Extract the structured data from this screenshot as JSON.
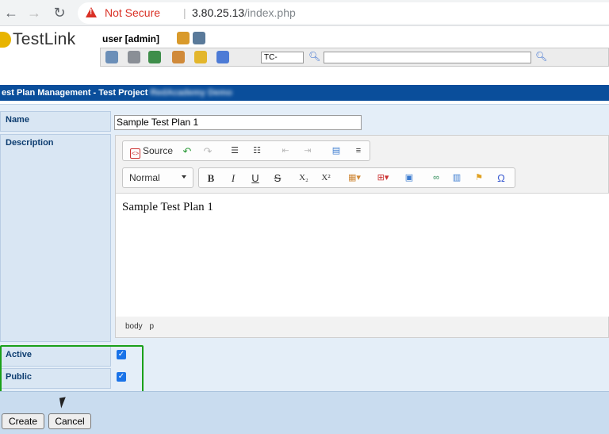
{
  "browser": {
    "back_icon": "arrow-left",
    "forward_icon": "arrow-right",
    "reload_icon": "reload",
    "security_label": "Not Secure",
    "url_host": "3.80.25.13",
    "url_path": "/index.php",
    "warning_color": "#d93025"
  },
  "header": {
    "logo_text": "TestLink",
    "user_label": "user [admin]",
    "tc_prefix": "TC-",
    "accent_color": "#0a4e9b"
  },
  "page": {
    "title": "est Plan Management - Test Project ",
    "project_name": "RedAcademy Demo"
  },
  "form": {
    "name_label": "Name",
    "name_value": "Sample Test Plan 1",
    "description_label": "Description",
    "active_label": "Active",
    "public_label": "Public",
    "active_checked": true,
    "public_checked": true,
    "check_glyph": "✓"
  },
  "editor": {
    "source_label": "Source",
    "format_label": "Normal",
    "content": "Sample Test Plan 1",
    "path_body": "body",
    "path_p": "p",
    "bold": "B",
    "italic": "I",
    "underline": "U",
    "strike": "S",
    "subscript": "X₂",
    "superscript": "X²",
    "omega": "Ω"
  },
  "actions": {
    "create_label": "Create",
    "cancel_label": "Cancel"
  }
}
